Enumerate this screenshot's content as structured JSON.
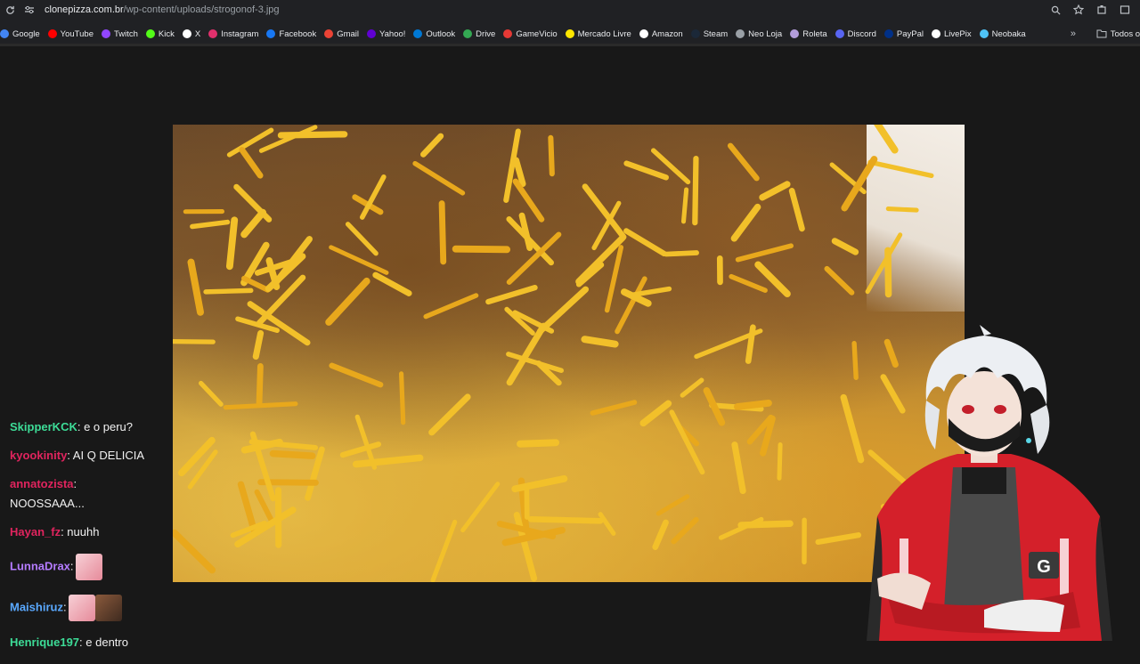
{
  "browser": {
    "url_host": "clonepizza.com.br",
    "url_path": "/wp-content/uploads/strogonof-3.jpg"
  },
  "bookmarks": [
    {
      "label": "Google",
      "color": "#4285f4"
    },
    {
      "label": "YouTube",
      "color": "#ff0000"
    },
    {
      "label": "Twitch",
      "color": "#9146ff"
    },
    {
      "label": "Kick",
      "color": "#53fc18"
    },
    {
      "label": "X",
      "color": "#ffffff"
    },
    {
      "label": "Instagram",
      "color": "#e1306c"
    },
    {
      "label": "Facebook",
      "color": "#1877f2"
    },
    {
      "label": "Gmail",
      "color": "#ea4335"
    },
    {
      "label": "Yahoo!",
      "color": "#6001d2"
    },
    {
      "label": "Outlook",
      "color": "#0078d4"
    },
    {
      "label": "Drive",
      "color": "#34a853"
    },
    {
      "label": "GameVicio",
      "color": "#e53935"
    },
    {
      "label": "Mercado Livre",
      "color": "#ffe600"
    },
    {
      "label": "Amazon",
      "color": "#ffffff"
    },
    {
      "label": "Steam",
      "color": "#1b2838"
    },
    {
      "label": "Neo Loja",
      "color": "#9aa0a6"
    },
    {
      "label": "Roleta",
      "color": "#b39ddb"
    },
    {
      "label": "Discord",
      "color": "#5865f2"
    },
    {
      "label": "PayPal",
      "color": "#003087"
    },
    {
      "label": "LivePix",
      "color": "#ffffff"
    },
    {
      "label": "Neobaka",
      "color": "#4fc3f7"
    }
  ],
  "bookmarks_folder": "Todos o",
  "chat": [
    {
      "user": "SkipperKCK",
      "color": "#3ddc97",
      "text": ": e o peru?"
    },
    {
      "user": "kyookinity",
      "color": "#e0245e",
      "text": ": AI Q DELICIA"
    },
    {
      "user": "annatozista",
      "color": "#e0245e",
      "text": ":",
      "line2": "NOOSSAAA..."
    },
    {
      "user": "Hayan_fz",
      "color": "#e0245e",
      "text": ": nuuhh"
    },
    {
      "user": "LunnaDrax",
      "color": "#b57cff",
      "text": ":",
      "emote": true
    },
    {
      "user": "Maishiruz",
      "color": "#5aa9ff",
      "text": ":",
      "emote": true,
      "emote2": true
    },
    {
      "user": "Henrique197",
      "color": "#3ddc97",
      "text": ": e dentro"
    }
  ]
}
